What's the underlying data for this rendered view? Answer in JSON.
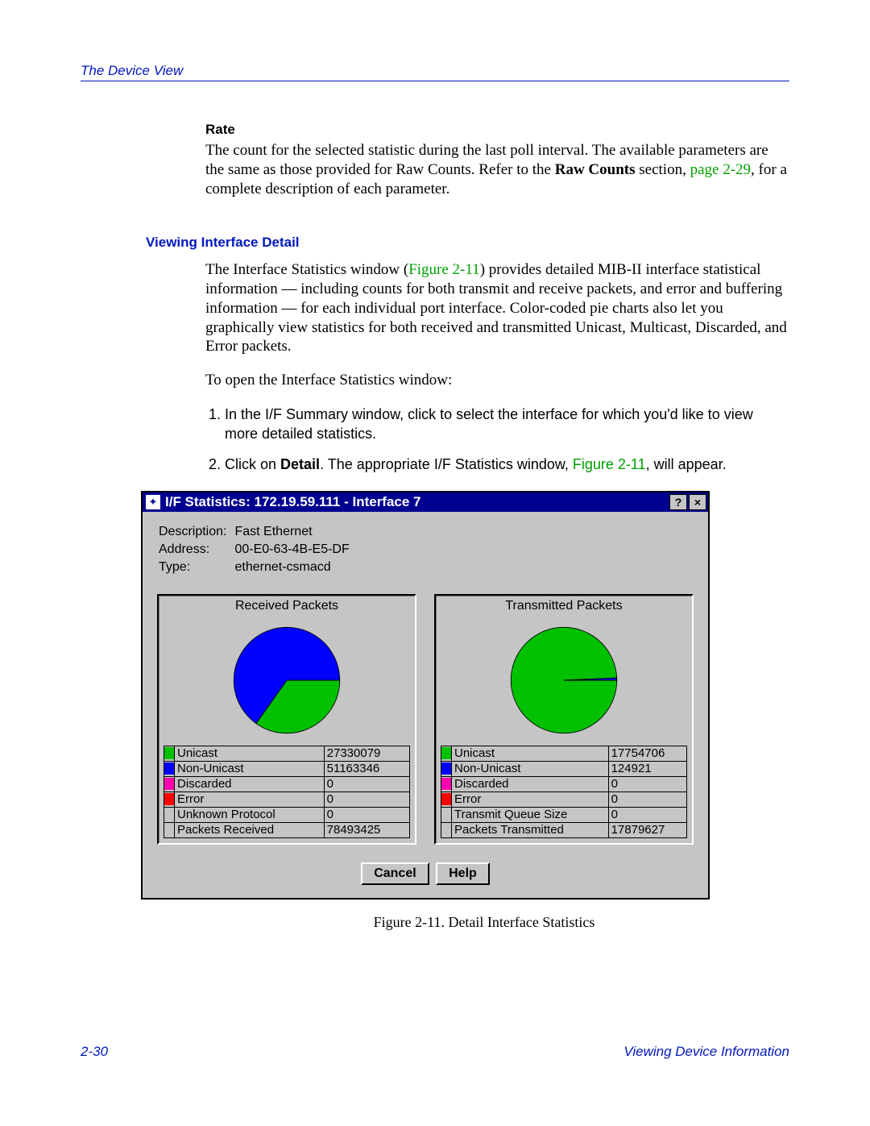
{
  "header": {
    "left": "The Device View",
    "right": ""
  },
  "rate": {
    "heading": "Rate",
    "text_1": "The count for the selected statistic during the last poll interval. The available parameters are the same as those provided for Raw Counts. Refer to the ",
    "raw_counts": "Raw Counts",
    "text_2": " section, ",
    "page_ref": "page 2-29",
    "text_3": ", for a complete description of each parameter."
  },
  "section": {
    "heading": "Viewing Interface Detail",
    "para_a": "The Interface Statistics window (",
    "fig_ref": "Figure 2-11",
    "para_b": ") provides detailed MIB-II interface statistical information — including counts for both transmit and receive packets, and error and buffering information — for each individual port interface. Color-coded pie charts also let you graphically view statistics for both received and transmitted Unicast, Multicast, Discarded, and Error packets.",
    "para_open": "To open the Interface Statistics window:",
    "step1": "In the I/F Summary window, click to select the interface for which you'd like to view more detailed statistics.",
    "step2_a": "Click on ",
    "step2_detail": "Detail",
    "step2_b": ". The appropriate I/F Statistics window, ",
    "step2_c": ", will appear."
  },
  "dialog": {
    "title": "I/F Statistics: 172.19.59.111 - Interface 7",
    "info": {
      "desc_label": "Description:",
      "desc_value": "Fast Ethernet",
      "addr_label": "Address:",
      "addr_value": "00-E0-63-4B-E5-DF",
      "type_label": "Type:",
      "type_value": "ethernet-csmacd"
    },
    "received": {
      "title": "Received Packets",
      "rows": [
        {
          "color": "#00c000",
          "label": "Unicast",
          "value": "27330079"
        },
        {
          "color": "#0000ff",
          "label": "Non-Unicast",
          "value": "51163346"
        },
        {
          "color": "#ff00b0",
          "label": "Discarded",
          "value": "0"
        },
        {
          "color": "#ff0000",
          "label": "Error",
          "value": "0"
        },
        {
          "color": "",
          "label": "Unknown Protocol",
          "value": "0"
        },
        {
          "color": "",
          "label": "Packets Received",
          "value": "78493425"
        }
      ]
    },
    "transmitted": {
      "title": "Transmitted Packets",
      "rows": [
        {
          "color": "#00c000",
          "label": "Unicast",
          "value": "17754706"
        },
        {
          "color": "#0000ff",
          "label": "Non-Unicast",
          "value": "124921"
        },
        {
          "color": "#ff00b0",
          "label": "Discarded",
          "value": "0"
        },
        {
          "color": "#ff0000",
          "label": "Error",
          "value": "0"
        },
        {
          "color": "",
          "label": "Transmit Queue Size",
          "value": "0"
        },
        {
          "color": "",
          "label": "Packets Transmitted",
          "value": "17879627"
        }
      ]
    },
    "buttons": {
      "cancel": "Cancel",
      "help": "Help"
    }
  },
  "caption": "Figure 2-11.  Detail Interface Statistics",
  "footer": {
    "left": "2-30",
    "right": "Viewing Device Information"
  },
  "chart_data": [
    {
      "type": "pie",
      "title": "Received Packets",
      "series": [
        {
          "name": "Unicast",
          "value": 27330079,
          "color": "#00c000"
        },
        {
          "name": "Non-Unicast",
          "value": 51163346,
          "color": "#0000ff"
        },
        {
          "name": "Discarded",
          "value": 0,
          "color": "#ff00b0"
        },
        {
          "name": "Error",
          "value": 0,
          "color": "#ff0000"
        }
      ]
    },
    {
      "type": "pie",
      "title": "Transmitted Packets",
      "series": [
        {
          "name": "Unicast",
          "value": 17754706,
          "color": "#00c000"
        },
        {
          "name": "Non-Unicast",
          "value": 124921,
          "color": "#0000ff"
        },
        {
          "name": "Discarded",
          "value": 0,
          "color": "#ff00b0"
        },
        {
          "name": "Error",
          "value": 0,
          "color": "#ff0000"
        }
      ]
    }
  ]
}
